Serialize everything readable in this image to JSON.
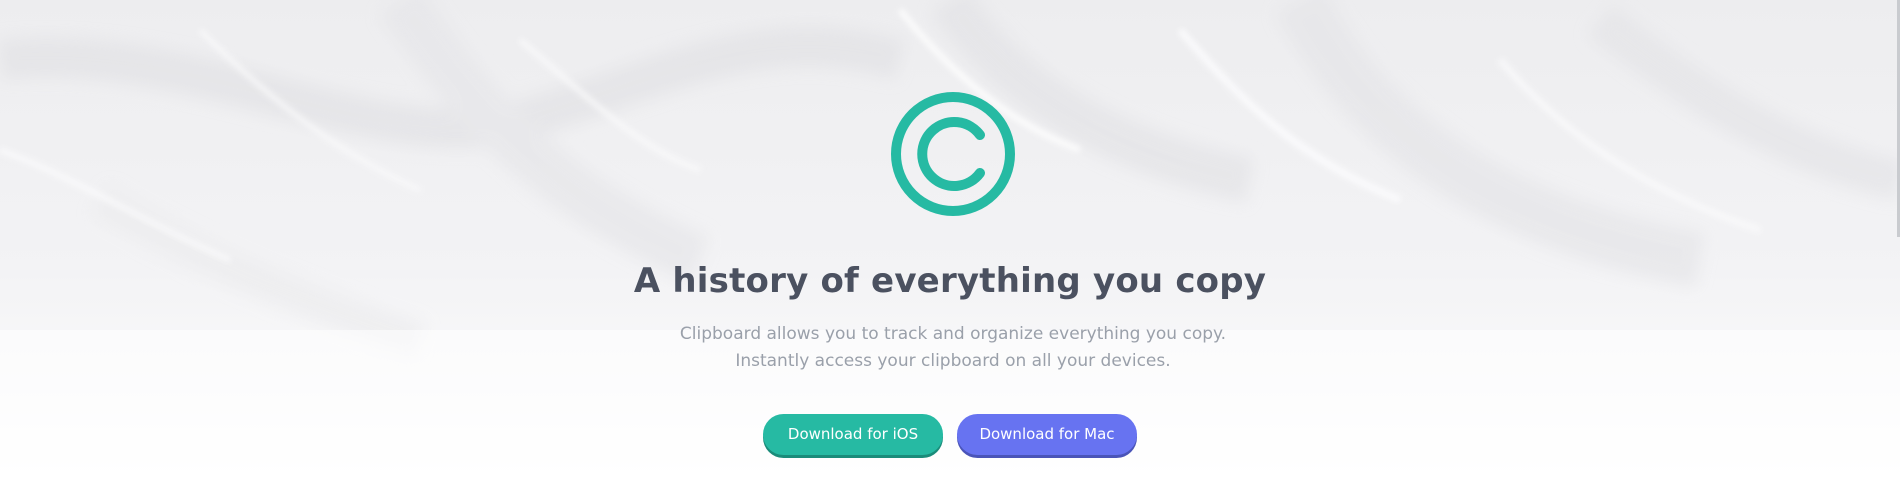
{
  "hero": {
    "logo_icon": "copyright-c-icon",
    "title": "A history of everything you copy",
    "subtitle": "Clipboard allows you to track and organize everything you copy. Instantly access your clipboard on all your devices.",
    "buttons": [
      {
        "label": "Download for iOS",
        "color": "#26baa3"
      },
      {
        "label": "Download for Mac",
        "color": "#6773f1"
      }
    ]
  },
  "colors": {
    "accent": "#26baa3",
    "secondary": "#6773f1",
    "heading": "#4b5160",
    "body_text": "#9aa0aa"
  }
}
